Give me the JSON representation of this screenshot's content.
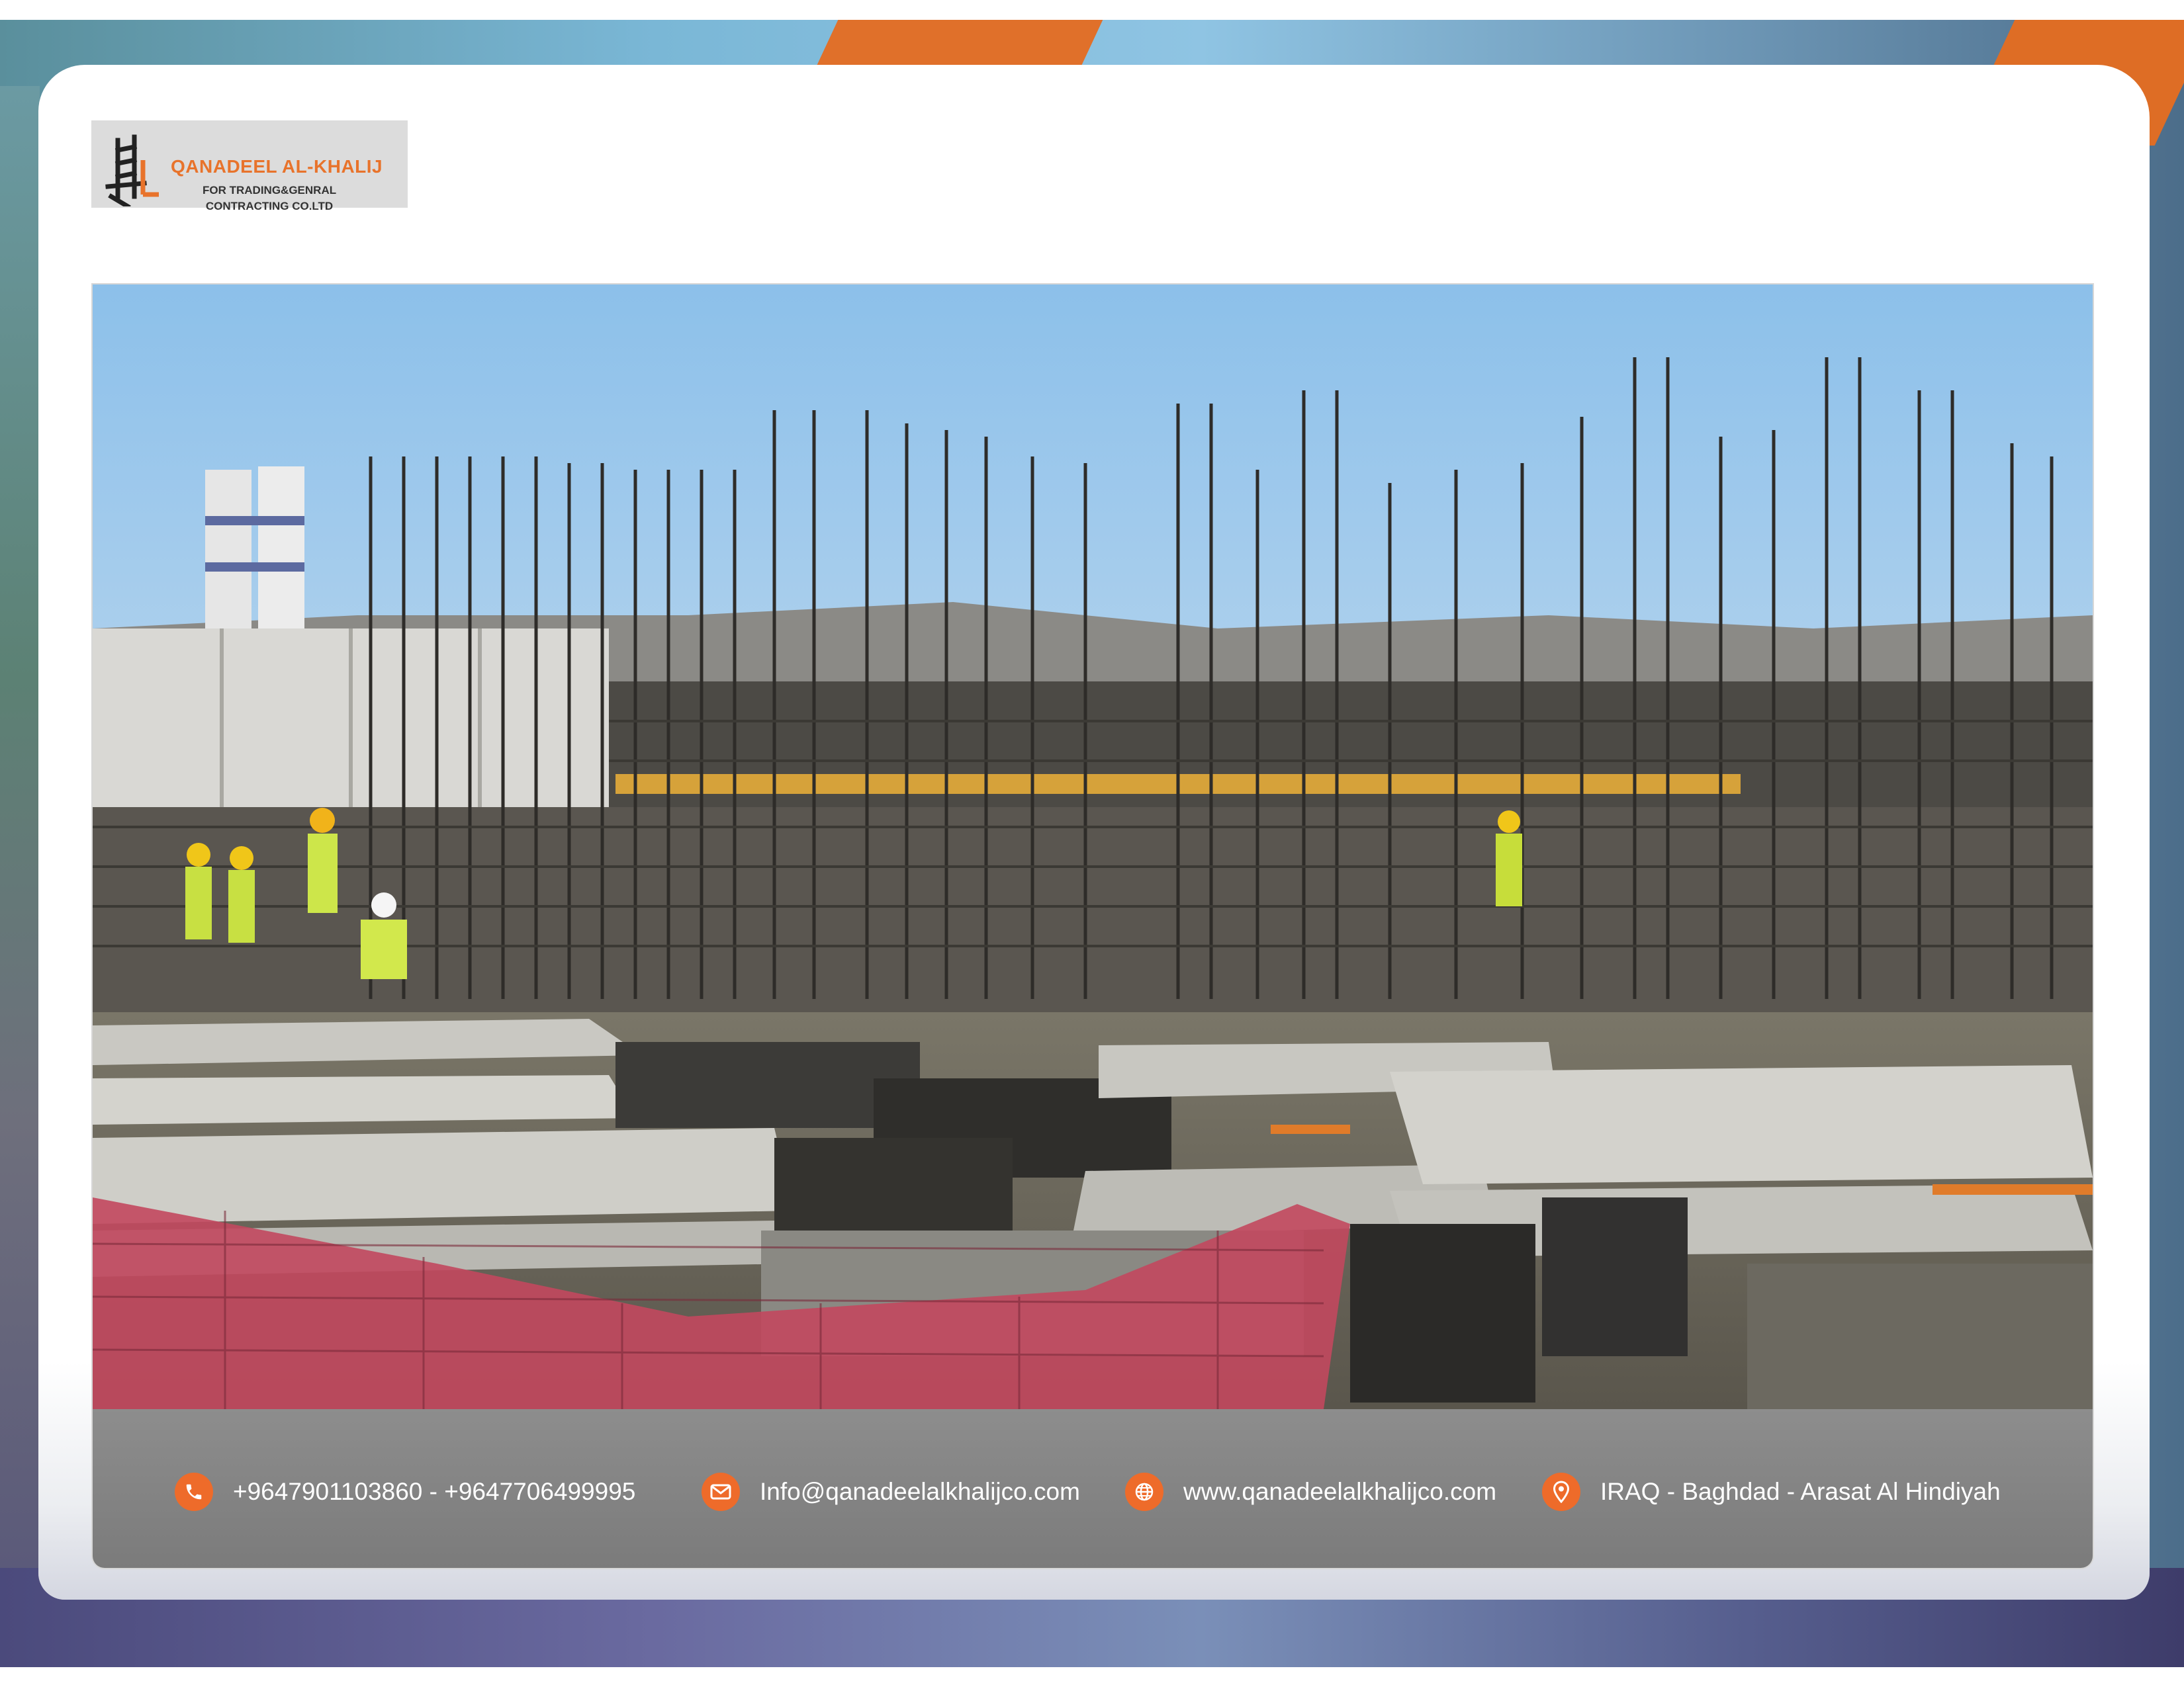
{
  "logo": {
    "name": "QANADEEL AL-KHALIJ",
    "subtitle_line1": "FOR TRADING&GENRAL",
    "subtitle_line2": "CONTRACTING CO.LTD"
  },
  "photo": {
    "subject": "construction-site"
  },
  "contact": {
    "phone": "+9647901103860 - +9647706499995",
    "email": "Info@qanadeelalkhalijco.com",
    "website": "www.qanadeelalkhalijco.com",
    "address": "IRAQ - Baghdad - Arasat Al Hindiyah",
    "icons": [
      "phone-icon",
      "email-icon",
      "globe-icon",
      "location-pin-icon"
    ],
    "accent_color": "#ee6b2a"
  }
}
